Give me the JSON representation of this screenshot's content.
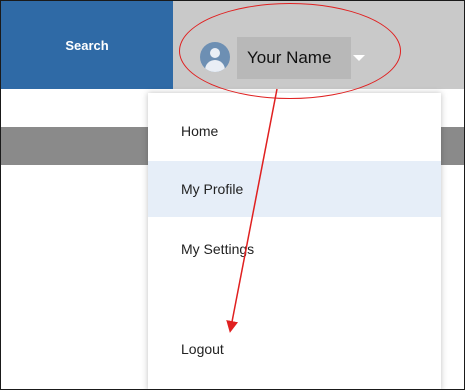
{
  "header": {
    "search_label": "Search",
    "user_name": "Your Name"
  },
  "menu": {
    "items": [
      {
        "label": "Home",
        "active": false
      },
      {
        "label": "My Profile",
        "active": true
      },
      {
        "label": "My Settings",
        "active": false
      },
      {
        "label": "Logout",
        "active": false
      }
    ]
  },
  "colors": {
    "header_blue": "#2f6aa6",
    "active_row": "#e6eef8",
    "annotation": "#e02020"
  },
  "icons": {
    "avatar": "user-avatar-icon",
    "caret": "chevron-down-icon"
  }
}
